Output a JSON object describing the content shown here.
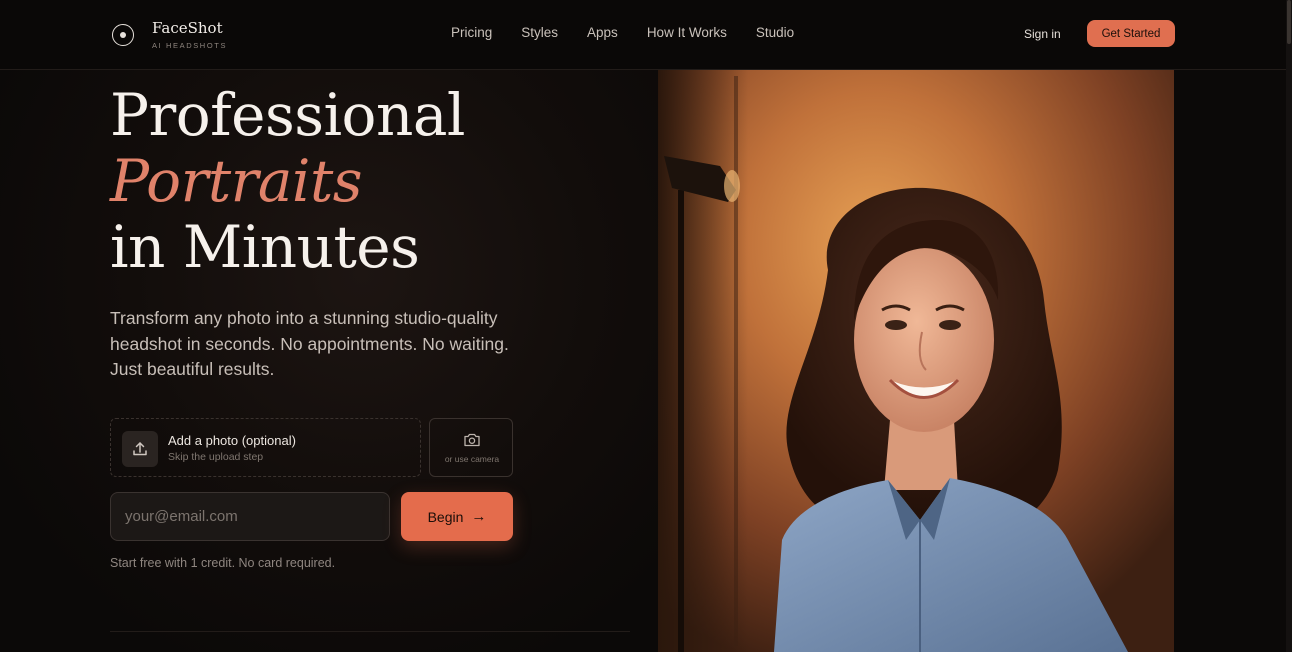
{
  "brand": {
    "name": "FaceShot",
    "tagline": "AI HEADSHOTS"
  },
  "nav": {
    "links": [
      "Pricing",
      "Styles",
      "Apps",
      "How It Works",
      "Studio"
    ],
    "signin": "Sign in",
    "cta": "Get Started"
  },
  "hero": {
    "title_line1": "Professional",
    "title_accent": "Portraits",
    "title_line3": "in Minutes",
    "lead": "Transform any photo into a stunning studio-quality headshot in seconds. No appointments. No waiting. Just beautiful results.",
    "upload_title": "Add a photo (optional)",
    "upload_sub": "Skip the upload step",
    "camera_label": "or use camera",
    "email_placeholder": "your@email.com",
    "begin": "Begin",
    "note": "Start free with 1 credit. No card required."
  },
  "icons": {
    "upload": "upload-icon",
    "camera": "camera-icon",
    "arrow": "arrow-right-icon",
    "logo": "logo-icon"
  },
  "colors": {
    "accent": "#e06f50",
    "background": "#0b0908"
  }
}
